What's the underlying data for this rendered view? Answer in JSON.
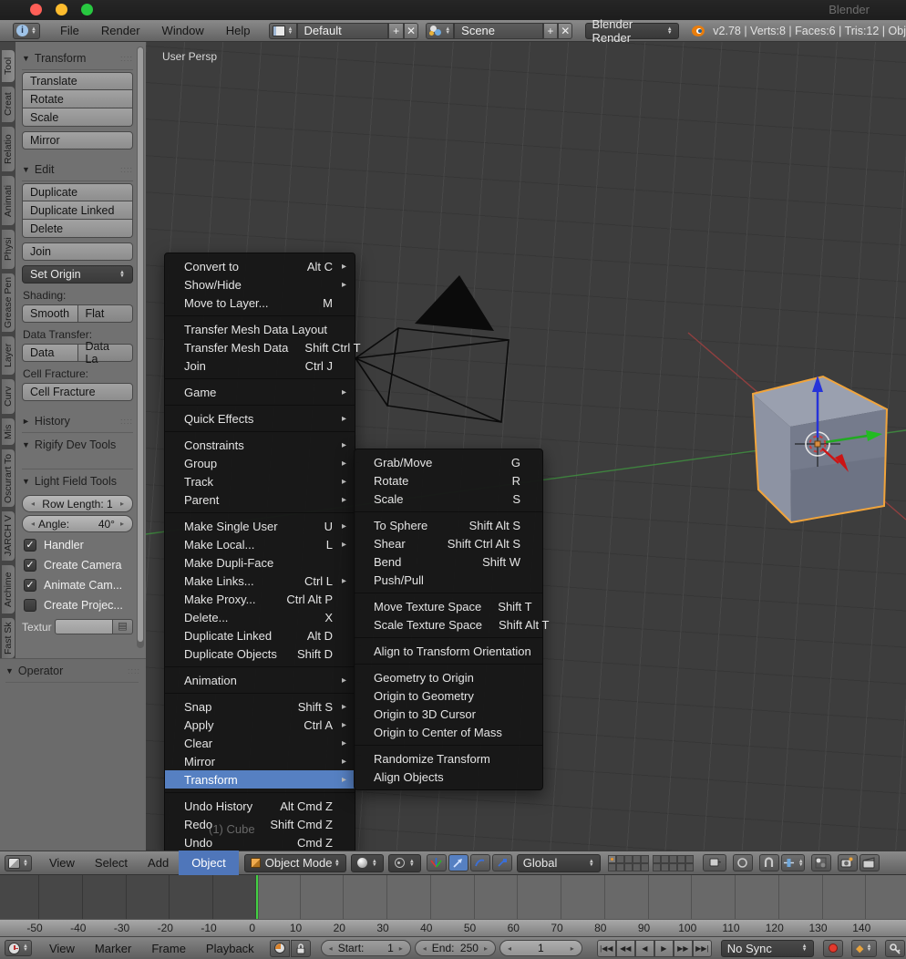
{
  "window": {
    "title": "Blender"
  },
  "infobar": {
    "menus": [
      "File",
      "Render",
      "Window",
      "Help"
    ],
    "layout_value": "Default",
    "scene_value": "Scene",
    "engine_value": "Blender Render",
    "stats": "v2.78 | Verts:8 | Faces:6 | Tris:12 | Obj"
  },
  "toolshelf": {
    "tabs": [
      "Tool",
      "Creat",
      "Relatio",
      "Animati",
      "Physi",
      "Grease Pen",
      "Layer",
      "Curv",
      "Mis",
      "Oscurart To",
      "JARCH V",
      "Archime",
      "Fast Sk"
    ],
    "transform_panel": {
      "title": "Transform",
      "buttons": [
        "Translate",
        "Rotate",
        "Scale"
      ],
      "mirror": "Mirror"
    },
    "edit_panel": {
      "title": "Edit",
      "buttons": [
        "Duplicate",
        "Duplicate Linked",
        "Delete"
      ],
      "join": "Join",
      "set_origin": "Set Origin"
    },
    "shading_label": "Shading:",
    "shading_buttons": [
      "Smooth",
      "Flat"
    ],
    "data_transfer_label": "Data Transfer:",
    "data_transfer_buttons": [
      "Data",
      "Data La"
    ],
    "cell_fracture_label": "Cell Fracture:",
    "cell_fracture_button": "Cell Fracture",
    "history_title": "History",
    "rigify_title": "Rigify Dev Tools",
    "light_field_title": "Light Field Tools",
    "row_length_slider": "Row Length: 1",
    "angle_label": "Angle:",
    "angle_value": "40°",
    "checkboxes": [
      {
        "label": "Handler",
        "checked": true
      },
      {
        "label": "Create Camera",
        "checked": true
      },
      {
        "label": "Animate Cam...",
        "checked": true
      },
      {
        "label": "Create Projec...",
        "checked": false
      }
    ],
    "texture_label": "Textur",
    "operator_title": "Operator"
  },
  "viewport": {
    "view_label": "User Persp",
    "object_label": "(1) Cube"
  },
  "object_menu": {
    "items": [
      {
        "label": "Convert to",
        "shortcut": "Alt C",
        "arrow": true
      },
      {
        "label": "Show/Hide",
        "arrow": true
      },
      {
        "label": "Move to Layer...",
        "shortcut": "M"
      },
      {
        "sep": true
      },
      {
        "label": "Transfer Mesh Data Layout"
      },
      {
        "label": "Transfer Mesh Data",
        "shortcut": "Shift Ctrl T"
      },
      {
        "label": "Join",
        "shortcut": "Ctrl J"
      },
      {
        "sep": true
      },
      {
        "label": "Game",
        "arrow": true
      },
      {
        "sep": true
      },
      {
        "label": "Quick Effects",
        "arrow": true
      },
      {
        "sep": true
      },
      {
        "label": "Constraints",
        "arrow": true
      },
      {
        "label": "Group",
        "arrow": true
      },
      {
        "label": "Track",
        "arrow": true
      },
      {
        "label": "Parent",
        "arrow": true
      },
      {
        "sep": true
      },
      {
        "label": "Make Single User",
        "shortcut": "U",
        "arrow": true
      },
      {
        "label": "Make Local...",
        "shortcut": "L",
        "arrow": true
      },
      {
        "label": "Make Dupli-Face"
      },
      {
        "label": "Make Links...",
        "shortcut": "Ctrl L",
        "arrow": true
      },
      {
        "label": "Make Proxy...",
        "shortcut": "Ctrl Alt P"
      },
      {
        "label": "Delete...",
        "shortcut": "X"
      },
      {
        "label": "Duplicate Linked",
        "shortcut": "Alt D"
      },
      {
        "label": "Duplicate Objects",
        "shortcut": "Shift D"
      },
      {
        "sep": true
      },
      {
        "label": "Animation",
        "arrow": true
      },
      {
        "sep": true
      },
      {
        "label": "Snap",
        "shortcut": "Shift S",
        "arrow": true
      },
      {
        "label": "Apply",
        "shortcut": "Ctrl A",
        "arrow": true
      },
      {
        "label": "Clear",
        "arrow": true
      },
      {
        "label": "Mirror",
        "arrow": true
      },
      {
        "label": "Transform",
        "arrow": true,
        "highlighted": true
      },
      {
        "sep": true
      },
      {
        "label": "Undo History",
        "shortcut": "Alt Cmd Z"
      },
      {
        "label": "Redo",
        "shortcut": "Shift Cmd Z"
      },
      {
        "label": "Undo",
        "shortcut": "Cmd Z"
      }
    ]
  },
  "transform_submenu": {
    "items": [
      {
        "label": "Grab/Move",
        "shortcut": "G"
      },
      {
        "label": "Rotate",
        "shortcut": "R"
      },
      {
        "label": "Scale",
        "shortcut": "S"
      },
      {
        "sep": true
      },
      {
        "label": "To Sphere",
        "shortcut": "Shift Alt S"
      },
      {
        "label": "Shear",
        "shortcut": "Shift Ctrl Alt S"
      },
      {
        "label": "Bend",
        "shortcut": "Shift W"
      },
      {
        "label": "Push/Pull"
      },
      {
        "sep": true
      },
      {
        "label": "Move Texture Space",
        "shortcut": "Shift T"
      },
      {
        "label": "Scale Texture Space",
        "shortcut": "Shift Alt T"
      },
      {
        "sep": true
      },
      {
        "label": "Align to Transform Orientation"
      },
      {
        "sep": true
      },
      {
        "label": "Geometry to Origin"
      },
      {
        "label": "Origin to Geometry"
      },
      {
        "label": "Origin to 3D Cursor"
      },
      {
        "label": "Origin to Center of Mass"
      },
      {
        "sep": true
      },
      {
        "label": "Randomize Transform"
      },
      {
        "label": "Align Objects"
      }
    ]
  },
  "view3d_header": {
    "menus": [
      "View",
      "Select",
      "Add",
      "Object"
    ],
    "active_menu": "Object",
    "mode_value": "Object Mode",
    "orientation_value": "Global"
  },
  "timeline": {
    "ruler_ticks": [
      -50,
      -40,
      -30,
      -20,
      -10,
      0,
      10,
      20,
      30,
      40,
      50,
      60,
      70,
      80,
      90,
      100,
      110,
      120,
      130,
      140
    ],
    "menus": [
      "View",
      "Marker",
      "Frame",
      "Playback"
    ],
    "start_label": "Start:",
    "start_value": "1",
    "end_label": "End:",
    "end_value": "250",
    "frame_value": "1",
    "sync_value": "No Sync",
    "playback_icons": [
      "jump-to-start",
      "prev-keyframe",
      "play-reverse",
      "play",
      "next-keyframe",
      "jump-to-end"
    ]
  },
  "icons": {
    "menu_arrow": "▸",
    "panel_open": "▼",
    "panel_closed": "►",
    "checkmark": "✓",
    "status_colors": {
      "selection_orange": "#f0a43c",
      "highlight_blue": "#5680c2",
      "playhead_green": "#43cf43",
      "record_red": "#e33a2e"
    }
  }
}
